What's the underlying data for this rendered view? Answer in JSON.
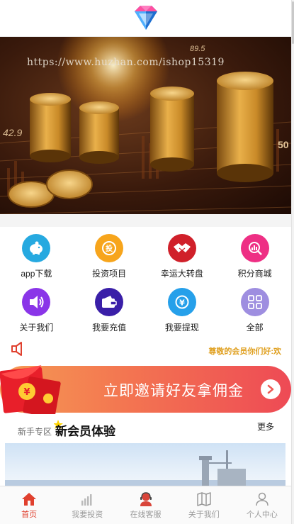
{
  "colors": {
    "accent": "#e0402e",
    "notice_text": "#e0a020",
    "invite_gradient_start": "#f59a52",
    "invite_gradient_end": "#ee4a55"
  },
  "header": {
    "logo_icon": "diamond-logo-icon"
  },
  "banner": {
    "watermark": "https://www.huzhan.com/ishop15319",
    "numbers": [
      "42.9",
      "89.5",
      "50"
    ]
  },
  "grid": {
    "items": [
      {
        "label": "app下载",
        "icon": "piggy-bank-icon",
        "color": "#26a9e0"
      },
      {
        "label": "投资项目",
        "icon": "invest-coin-icon",
        "color": "#f7a51c"
      },
      {
        "label": "幸运大转盘",
        "icon": "handshake-icon",
        "color": "#d0202a"
      },
      {
        "label": "积分商城",
        "icon": "chart-search-icon",
        "color": "#ee2f84"
      },
      {
        "label": "关于我们",
        "icon": "speaker-icon",
        "color": "#8a35e8"
      },
      {
        "label": "我要充值",
        "icon": "wallet-icon",
        "color": "#3a1fa8"
      },
      {
        "label": "我要提现",
        "icon": "yen-withdraw-icon",
        "color": "#26a0ea"
      },
      {
        "label": "全部",
        "icon": "grid-all-icon",
        "color": "#9e8ee0"
      }
    ]
  },
  "notice": {
    "icon": "megaphone-icon",
    "message": "尊敬的会员你们好:欢"
  },
  "invite": {
    "text": "立即邀请好友拿佣金",
    "icon": "chevron-right-icon"
  },
  "section": {
    "zone_label": "新手专区",
    "title_image_text": "新会员体验",
    "more_label": "更多"
  },
  "tabbar": {
    "tabs": [
      {
        "label": "首页",
        "icon": "home-icon",
        "active": true
      },
      {
        "label": "我要投资",
        "icon": "bar-chart-icon",
        "active": false
      },
      {
        "label": "在线客服",
        "icon": "customer-service-icon",
        "active": false
      },
      {
        "label": "关于我们",
        "icon": "map-book-icon",
        "active": false
      },
      {
        "label": "个人中心",
        "icon": "user-icon",
        "active": false
      }
    ]
  }
}
